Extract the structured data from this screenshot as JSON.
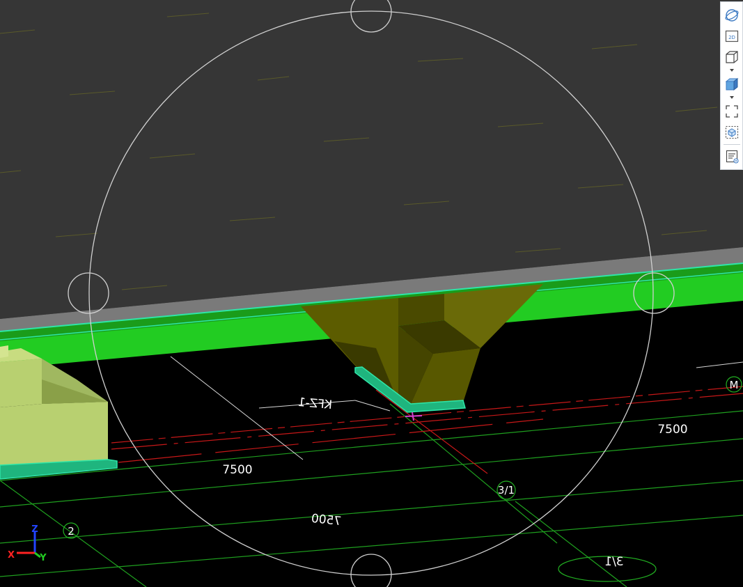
{
  "viewport": {
    "dimension_labels": [
      "7500",
      "7500"
    ],
    "mirrored_dimension_label": "7500",
    "beam_label": "KFZ-1",
    "grid_labels": {
      "grid_2": "2",
      "grid_3_1": "3/1",
      "grid_m": "M",
      "mirrored_grid": "3/1"
    },
    "axis_triad": {
      "x": "X",
      "y": "Y",
      "z": "Z"
    },
    "colors": {
      "background": "#000000",
      "slab": "#363636",
      "beam": "#22cc22",
      "beam_edge": "#2ee6a8",
      "footing": "#5c5c00",
      "block": "#b8d070",
      "grid_line": "#22b022",
      "red_line": "#cc1a1a",
      "navigation_circle": "#d0d0d0"
    }
  },
  "toolbar": {
    "icons": [
      "orbit-icon",
      "view-2d-icon",
      "view-3d-box-icon",
      "shaded-cube-icon",
      "zoom-extents-icon",
      "selection-box-icon",
      "properties-icon"
    ],
    "view_2d_label": "2D"
  }
}
